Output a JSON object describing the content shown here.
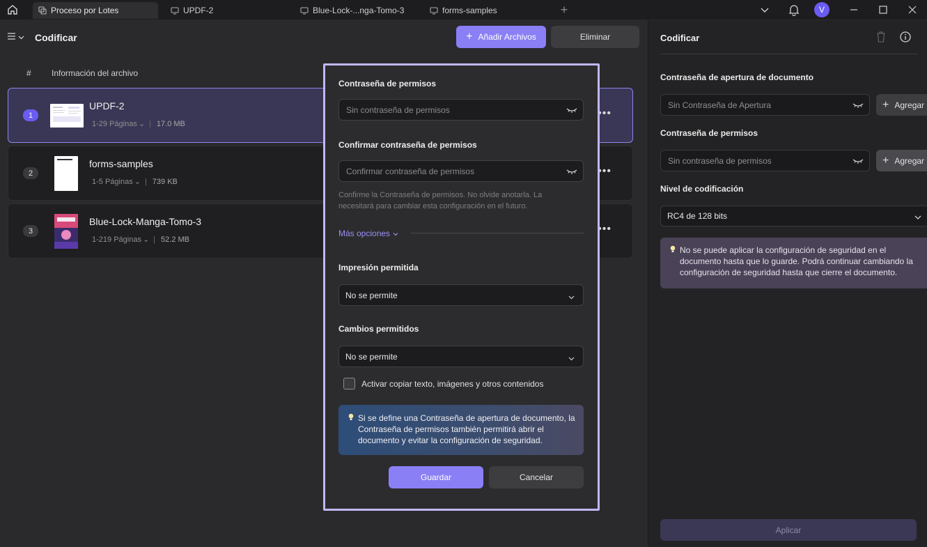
{
  "tabbar": {
    "tabs": [
      {
        "label": "Proceso por Lotes",
        "active": true
      },
      {
        "label": "UPDF-2",
        "active": false
      },
      {
        "label": "Blue-Lock-...nga-Tomo-3",
        "active": false
      },
      {
        "label": "forms-samples",
        "active": false
      }
    ],
    "avatar_initial": "V"
  },
  "header": {
    "title": "Codificar",
    "add_files_label": "Añadir Archivos",
    "delete_label": "Eliminar"
  },
  "columns": {
    "num": "#",
    "info": "Información del archivo"
  },
  "files": [
    {
      "num": "1",
      "name": "UPDF-2",
      "pages": "1-29 Páginas",
      "size": "17.0 MB",
      "selected": true
    },
    {
      "num": "2",
      "name": "forms-samples",
      "pages": "1-5 Páginas",
      "size": "739 KB",
      "selected": false
    },
    {
      "num": "3",
      "name": "Blue-Lock-Manga-Tomo-3",
      "pages": "1-219 Páginas",
      "size": "52.2 MB",
      "selected": false
    }
  ],
  "right_panel": {
    "title": "Codificar",
    "open_password_label": "Contraseña de apertura de documento",
    "open_password_placeholder": "Sin Contraseña de Apertura",
    "permissions_password_label": "Contraseña de permisos",
    "permissions_password_placeholder": "Sin contraseña de permisos",
    "add_label": "Agregar",
    "encryption_level_label": "Nivel de codificación",
    "encryption_level_value": "RC4 de 128 bits",
    "note": "No se puede aplicar la configuración de seguridad en el documento hasta que lo guarde. Podrá continuar cambiando la configuración de seguridad hasta que cierre el documento.",
    "apply_label": "Aplicar"
  },
  "modal": {
    "permissions_password_label": "Contraseña de permisos",
    "permissions_password_placeholder": "Sin contraseña de permisos",
    "confirm_label": "Confirmar contraseña de permisos",
    "confirm_placeholder": "Confirmar contraseña de permisos",
    "hint": "Confirme la Contraseña de permisos. No olvide anotarla. La necesitará para cambiar esta configuración en el futuro.",
    "more_options": "Más opciones",
    "printing_label": "Impresión permitida",
    "printing_value": "No se permite",
    "changes_label": "Cambios permitidos",
    "changes_value": "No se permite",
    "copy_checkbox_label": "Activar copiar texto, imágenes y otros contenidos",
    "note": "Si se define una Contraseña de apertura de documento, la Contraseña de permisos también permitirá abrir el documento  y evitar la configuración de seguridad.",
    "save_label": "Guardar",
    "cancel_label": "Cancelar"
  },
  "colors": {
    "accent": "#8a7ff5",
    "modal_border": "#c2b7f6",
    "selected_row": "#3a3756"
  }
}
